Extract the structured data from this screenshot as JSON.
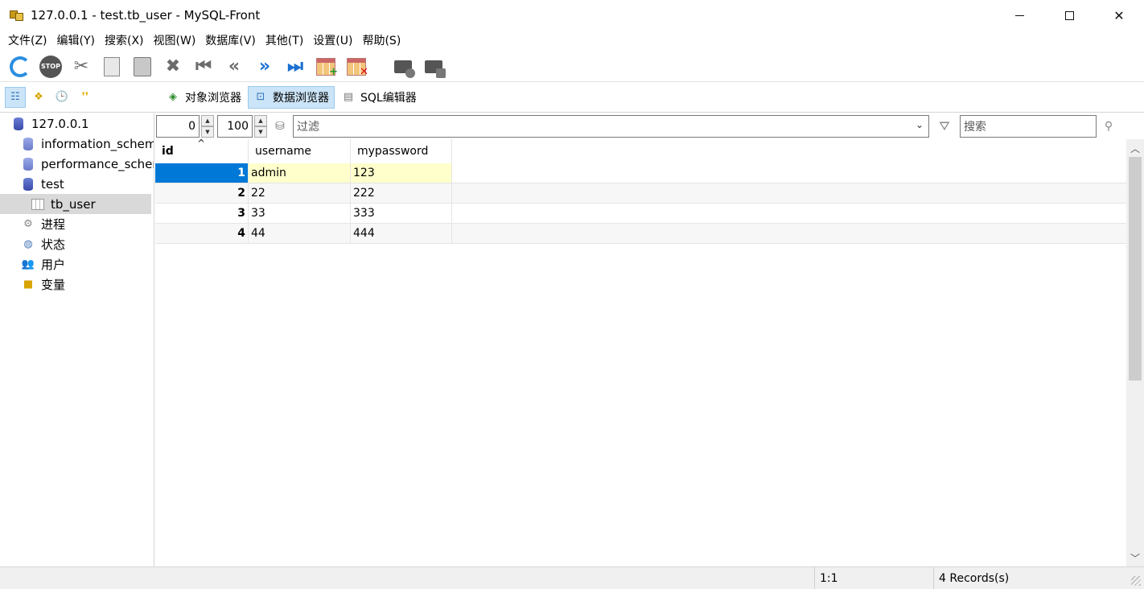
{
  "window": {
    "title": "127.0.0.1 - test.tb_user - MySQL-Front",
    "minimize_label": "",
    "close_label": "✕"
  },
  "menu": {
    "items": [
      "文件(Z)",
      "编辑(Y)",
      "搜索(X)",
      "视图(W)",
      "数据库(V)",
      "其他(T)",
      "设置(U)",
      "帮助(S)"
    ]
  },
  "toolbar": {
    "stop_label": "STOP"
  },
  "view_tabs": {
    "object_browser": "对象浏览器",
    "data_browser": "数据浏览器",
    "sql_editor": "SQL编辑器"
  },
  "tree": {
    "items": [
      {
        "label": "127.0.0.1",
        "icon": "server-icon"
      },
      {
        "label": "information_schem",
        "icon": "database-icon"
      },
      {
        "label": "performance_scher",
        "icon": "database-icon"
      },
      {
        "label": "test",
        "icon": "database-icon"
      },
      {
        "label": "tb_user",
        "icon": "table-icon",
        "selected": true
      },
      {
        "label": "进程",
        "icon": "processes-icon"
      },
      {
        "label": "状态",
        "icon": "status-icon"
      },
      {
        "label": "用户",
        "icon": "users-icon"
      },
      {
        "label": "变量",
        "icon": "variables-icon"
      }
    ]
  },
  "filter": {
    "offset": "0",
    "limit": "100",
    "filter_placeholder": "过滤",
    "search_placeholder": "搜索"
  },
  "grid": {
    "columns": [
      "id",
      "username",
      "mypassword"
    ],
    "rows": [
      {
        "id": "1",
        "username": "admin",
        "mypassword": "123"
      },
      {
        "id": "2",
        "username": "22",
        "mypassword": "222"
      },
      {
        "id": "3",
        "username": "33",
        "mypassword": "333"
      },
      {
        "id": "4",
        "username": "44",
        "mypassword": "444"
      }
    ],
    "current_row": 0
  },
  "status": {
    "position": "1:1",
    "records": "4 Records(s)"
  },
  "colors": {
    "selection": "#0078d7",
    "current_row_bg": "#ffffcc",
    "active_tab_bg": "#cce4f7"
  }
}
